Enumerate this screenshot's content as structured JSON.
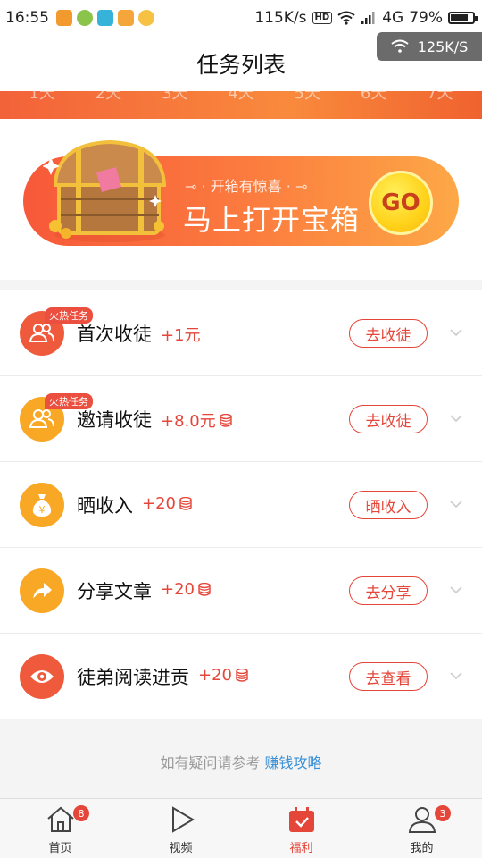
{
  "status_bar": {
    "time": "16:55",
    "speed": "115K/s",
    "hd": "HD",
    "network": "4G",
    "battery": "79%",
    "battery_level": 0.79
  },
  "speed_toast": {
    "speed": "125K/S"
  },
  "header": {
    "title": "任务列表"
  },
  "day_strip": {
    "days": [
      "1天",
      "2天",
      "3天",
      "4天",
      "5天",
      "6天",
      "7天"
    ]
  },
  "treasure": {
    "subtitle": "开箱有惊喜",
    "title": "马上打开宝箱",
    "go_label": "GO"
  },
  "tasks": [
    {
      "name": "首次收徒",
      "reward": "+1元",
      "coin": false,
      "hot": "火热任务",
      "button": "去收徒",
      "icon": "users-icon",
      "color": "#f05a3c"
    },
    {
      "name": "邀请收徒",
      "reward": "+8.0元",
      "coin": true,
      "hot": "火热任务",
      "button": "去收徒",
      "icon": "users-icon",
      "color": "#f9a825"
    },
    {
      "name": "晒收入",
      "reward": "+20",
      "coin": true,
      "hot": "",
      "button": "晒收入",
      "icon": "money-bag-icon",
      "color": "#f9a825"
    },
    {
      "name": "分享文章",
      "reward": "+20",
      "coin": true,
      "hot": "",
      "button": "去分享",
      "icon": "share-icon",
      "color": "#f9a825"
    },
    {
      "name": "徒弟阅读进贡",
      "reward": "+20",
      "coin": true,
      "hot": "",
      "button": "去查看",
      "icon": "eye-icon",
      "color": "#f05a3c"
    }
  ],
  "hint": {
    "text": "如有疑问请参考",
    "link": "赚钱攻略"
  },
  "tabbar": {
    "tabs": [
      {
        "label": "首页",
        "icon": "home-icon",
        "badge": "8"
      },
      {
        "label": "视频",
        "icon": "play-icon",
        "badge": ""
      },
      {
        "label": "福利",
        "icon": "calendar-icon",
        "badge": "",
        "active": true
      },
      {
        "label": "我的",
        "icon": "user-icon",
        "badge": "3"
      }
    ]
  },
  "colors": {
    "accent": "#e5463a",
    "orange": "#f98a3c",
    "link": "#3a8fd6"
  }
}
